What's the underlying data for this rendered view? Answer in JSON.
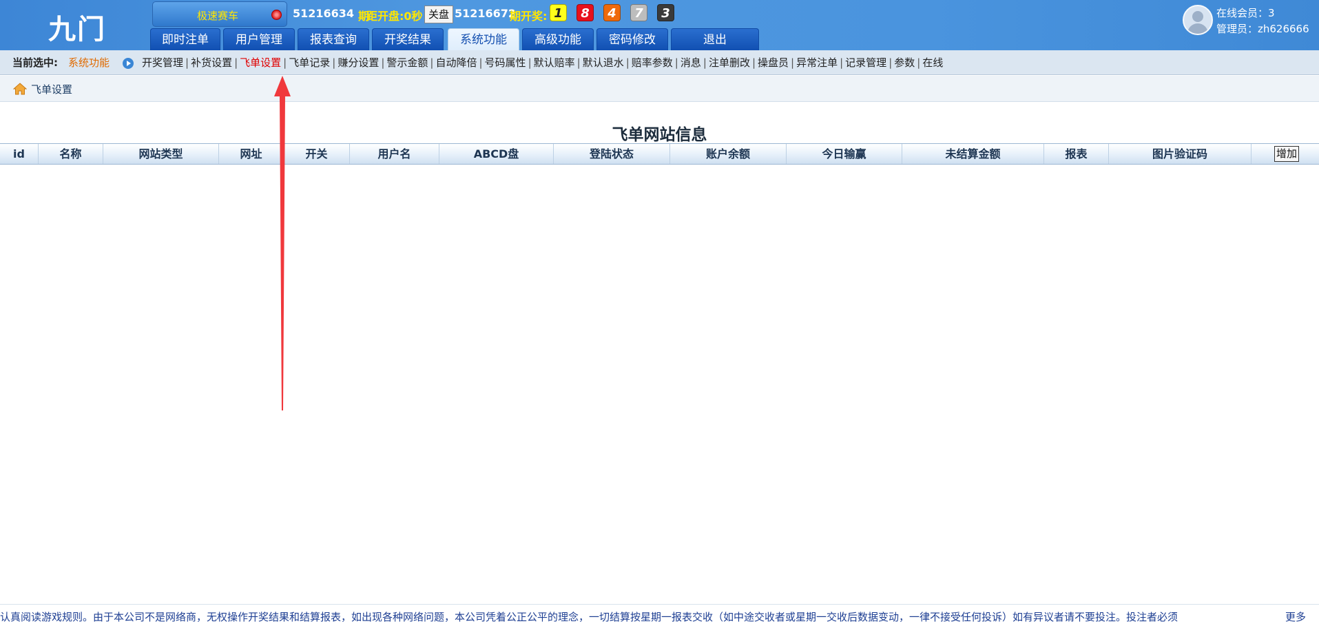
{
  "header": {
    "logo": "九门",
    "game_name": "极速赛车",
    "current_issue": "51216634",
    "issue_suffix": "期",
    "countdown": "距开盘:0秒",
    "close_button": "关盘",
    "last_draw_issue": "51216672",
    "last_draw_suffix": "期开奖:",
    "draw_balls": [
      {
        "num": "1",
        "color": "#ffff1a",
        "text_color": "#222222"
      },
      {
        "num": "8",
        "color": "#e8101c",
        "text_color": "#ffffff"
      },
      {
        "num": "4",
        "color": "#ef6a0c",
        "text_color": "#ffffff"
      },
      {
        "num": "7",
        "color": "#bdbdbd",
        "text_color": "#ffffff"
      },
      {
        "num": "3",
        "color": "#3a3a3a",
        "text_color": "#ffffff"
      }
    ],
    "online_members": "在线会员：3",
    "admin": "管理员：zh626666"
  },
  "nav": {
    "tabs": [
      {
        "label": "即时注单",
        "active": false
      },
      {
        "label": "用户管理",
        "active": false
      },
      {
        "label": "报表查询",
        "active": false
      },
      {
        "label": "开奖结果",
        "active": false
      },
      {
        "label": "系统功能",
        "active": true
      },
      {
        "label": "高级功能",
        "active": false
      },
      {
        "label": "密码修改",
        "active": false
      },
      {
        "label": "退出",
        "active": false
      }
    ]
  },
  "subnav": {
    "current_label": "当前选中:",
    "current_value": "系统功能",
    "items": [
      {
        "label": "开奖管理",
        "active": false
      },
      {
        "label": "补货设置",
        "active": false
      },
      {
        "label": "飞单设置",
        "active": true
      },
      {
        "label": "飞单记录",
        "active": false
      },
      {
        "label": "赚分设置",
        "active": false
      },
      {
        "label": "警示金额",
        "active": false
      },
      {
        "label": "自动降倍",
        "active": false
      },
      {
        "label": "号码属性",
        "active": false
      },
      {
        "label": "默认赔率",
        "active": false
      },
      {
        "label": "默认退水",
        "active": false
      },
      {
        "label": "赔率参数",
        "active": false
      },
      {
        "label": "消息",
        "active": false
      },
      {
        "label": "注单删改",
        "active": false
      },
      {
        "label": "操盘员",
        "active": false
      },
      {
        "label": "异常注单",
        "active": false
      },
      {
        "label": "记录管理",
        "active": false
      },
      {
        "label": "参数",
        "active": false
      },
      {
        "label": "在线",
        "active": false
      }
    ]
  },
  "breadcrumb": {
    "label": "飞单设置"
  },
  "main": {
    "title": "飞单网站信息",
    "columns": [
      "id",
      "名称",
      "网站类型",
      "网址",
      "开关",
      "用户名",
      "ABCD盘",
      "登陆状态",
      "账户余额",
      "今日输赢",
      "未结算金额",
      "报表",
      "图片验证码"
    ],
    "add_button": "增加"
  },
  "footer": {
    "marquee": "认真阅读游戏规则。由于本公司不是网络商，无权操作开奖结果和结算报表，如出现各种网络问题，本公司凭着公正公平的理念，一切结算按星期一报表交收（如中途交收者或星期一交收后数据变动，一律不接受任何投诉）如有异议者请不要投注。投注者必须",
    "more": "更多"
  },
  "colors": {
    "header_blue": "#4a94de",
    "tab_blue": "#1150b2",
    "active_submenu": "#e00000",
    "current_value": "#e06a00",
    "highlight_yellow": "#ffe600",
    "annotation_arrow": "#f0383c"
  }
}
